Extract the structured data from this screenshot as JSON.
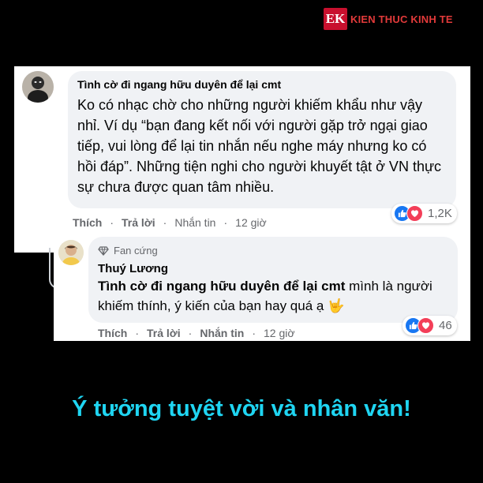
{
  "brand": {
    "logo_text": "EK",
    "name": "KIEN THUC KINH TE"
  },
  "comment1": {
    "author": "Tình cờ đi ngang hữu duyên để lại cmt",
    "text": "Ko có nhạc chờ cho những người khiếm khẩu như vậy nhỉ. Ví dụ “bạn đang kết nối với người gặp trở ngại giao tiếp, vui lòng để lại tin nhắn nếu nghe máy nhưng ko có hồi đáp”. Những tiện nghi cho người khuyết tật ở VN thực sự chưa được quan tâm nhiều.",
    "actions": {
      "like": "Thích",
      "reply": "Trả lời",
      "message": "Nhắn tin",
      "time": "12 giờ"
    },
    "reaction_count": "1,2K"
  },
  "comment2": {
    "badge": "Fan cứng",
    "author": "Thuý Lương",
    "mention": "Tình cờ đi ngang hữu duyên để lại cmt",
    "text": " mình là người khiếm thính, ý kiến của bạn hay quá ạ 🤟",
    "actions": {
      "like": "Thích",
      "reply": "Trả lời",
      "message": "Nhắn tin",
      "time": "12 giờ"
    },
    "reaction_count": "46"
  },
  "caption": "Ý tưởng tuyệt vời và nhân văn!",
  "colors": {
    "caption": "#1fd5f2",
    "brand": "#c8102e",
    "like": "#1877f2",
    "love": "#f33e58"
  }
}
